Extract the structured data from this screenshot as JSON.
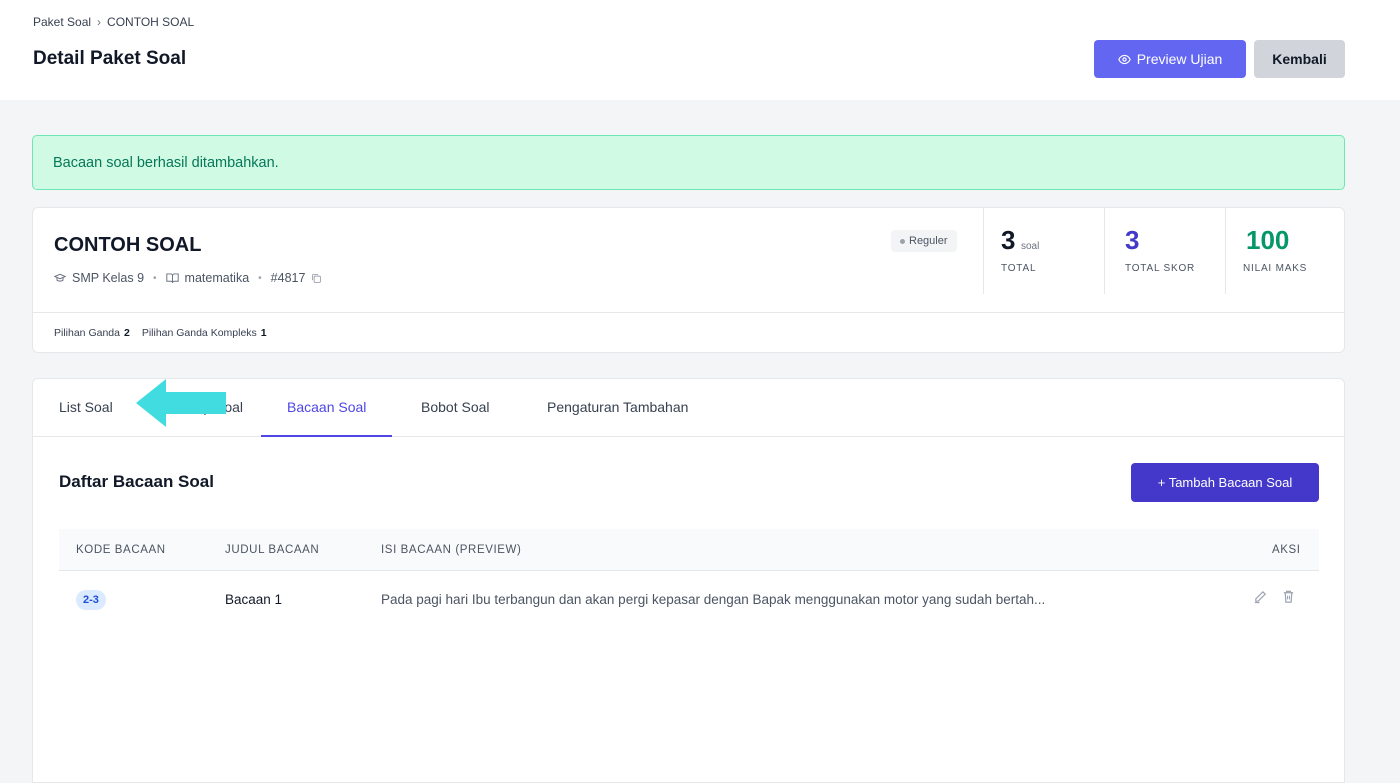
{
  "header": {
    "breadcrumb": [
      "Paket Soal",
      "CONTOH SOAL"
    ],
    "breadcrumb_separator": "›",
    "title": "Detail Paket Soal",
    "preview_label": "Preview Ujian",
    "back_label": "Kembali"
  },
  "alert": {
    "message": "Bacaan soal berhasil ditambahkan."
  },
  "package": {
    "name": "CONTOH SOAL",
    "level": "SMP Kelas 9",
    "subject": "matematika",
    "id": "#4817",
    "type_badge": "Reguler",
    "stats": {
      "total_value": "3",
      "total_unit": "soal",
      "total_label": "TOTAL",
      "score_value": "3",
      "score_label": "TOTAL SKOR",
      "max_value": "100",
      "max_label": "NILAI MAKS"
    },
    "question_types": [
      {
        "label": "Pilihan Ganda",
        "count": "2"
      },
      {
        "label": "Pilihan Ganda Kompleks",
        "count": "1"
      }
    ]
  },
  "tabs": [
    {
      "label": "List Soal"
    },
    {
      "label": "Grup Soal"
    },
    {
      "label": "Bacaan Soal",
      "active": true
    },
    {
      "label": "Bobot Soal"
    },
    {
      "label": "Pengaturan Tambahan"
    }
  ],
  "readings": {
    "title": "Daftar Bacaan Soal",
    "add_label": "+ Tambah Bacaan Soal",
    "columns": [
      "KODE BACAAN",
      "JUDUL BACAAN",
      "ISI BACAAN (PREVIEW)",
      "AKSI"
    ],
    "rows": [
      {
        "code": "2-3",
        "title": "Bacaan 1",
        "preview": "Pada pagi hari Ibu terbangun dan akan pergi kepasar dengan Bapak menggunakan motor yang sudah bertah..."
      }
    ]
  },
  "colors": {
    "primary": "#6366f1",
    "primary_dark": "#4338ca",
    "success_bg": "#d1fae5",
    "success_text": "#047857",
    "arrow": "#40dce0"
  },
  "icons": {
    "preview": "eye-icon",
    "level": "graduation-cap-icon",
    "subject": "book-icon",
    "copy": "copy-icon",
    "edit": "edit-icon",
    "delete": "trash-icon",
    "annotation": "arrow-left-icon"
  }
}
